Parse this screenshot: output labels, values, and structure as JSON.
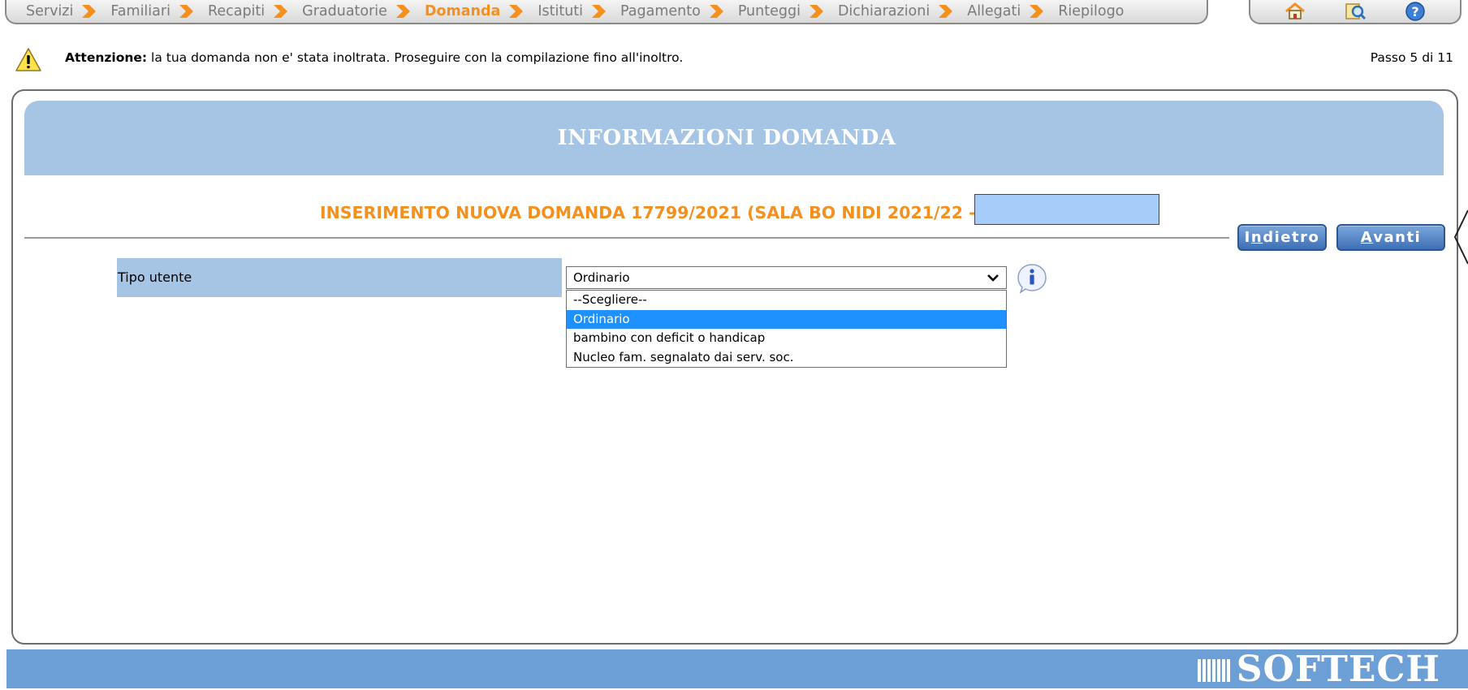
{
  "breadcrumb": {
    "items": [
      {
        "label": "Servizi",
        "active": false
      },
      {
        "label": "Familiari",
        "active": false
      },
      {
        "label": "Recapiti",
        "active": false
      },
      {
        "label": "Graduatorie",
        "active": false
      },
      {
        "label": "Domanda",
        "active": true
      },
      {
        "label": "Istituti",
        "active": false
      },
      {
        "label": "Pagamento",
        "active": false
      },
      {
        "label": "Punteggi",
        "active": false
      },
      {
        "label": "Dichiarazioni",
        "active": false
      },
      {
        "label": "Allegati",
        "active": false
      },
      {
        "label": "Riepilogo",
        "active": false
      }
    ],
    "active_color": "#f39020",
    "inactive_color": "#7b7b7b"
  },
  "toolbar": {
    "icons": [
      "home-icon",
      "search-icon",
      "help-icon"
    ]
  },
  "warning": {
    "icon": "warning-icon",
    "bold": "Attenzione:",
    "text": " la tua domanda non e' stata inoltrata. Proseguire con la compilazione fino all'inoltro.",
    "step": "Passo 5 di 11"
  },
  "header": {
    "title": "INFORMAZIONI DOMANDA"
  },
  "subtitle": {
    "text": "INSERIMENTO NUOVA DOMANDA 17799/2021 (SALA BO NIDI 2021/22 -"
  },
  "nav": {
    "back_label": "Indietro",
    "next_label": "Avanti"
  },
  "form": {
    "tipo_utente": {
      "label": "Tipo utente",
      "selected": "Ordinario",
      "options": [
        "--Scegliere--",
        "Ordinario",
        "bambino con deficit o handicap",
        "Nucleo fam. segnalato dai serv. soc."
      ],
      "highlighted_index": 1
    }
  },
  "footer": {
    "logo": "SOFTECH"
  },
  "colors": {
    "accent": "#f39020",
    "header_band": "#a6c4e3",
    "button": "#3e6fb5",
    "footer": "#6d9fd7",
    "selection": "#1e90ff"
  }
}
